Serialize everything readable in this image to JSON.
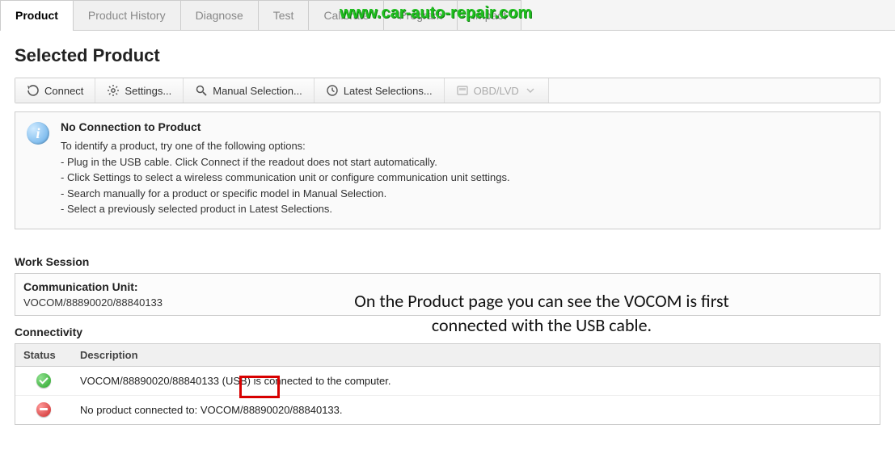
{
  "watermark": "www.car-auto-repair.com",
  "tabs": [
    {
      "label": "Product",
      "active": true
    },
    {
      "label": "Product History",
      "active": false
    },
    {
      "label": "Diagnose",
      "active": false
    },
    {
      "label": "Test",
      "active": false
    },
    {
      "label": "Calibrate",
      "active": false
    },
    {
      "label": "Program",
      "active": false
    },
    {
      "label": "Impact",
      "active": false
    }
  ],
  "page_title": "Selected Product",
  "toolbar": {
    "connect": "Connect",
    "settings": "Settings...",
    "manual": "Manual Selection...",
    "latest": "Latest Selections...",
    "obd": "OBD/LVD"
  },
  "info": {
    "title": "No Connection to Product",
    "intro": "To identify a product, try one of the following options:",
    "lines": [
      "- Plug in the USB cable. Click Connect if the readout does not start automatically.",
      "- Click Settings to select a wireless communication unit or configure communication unit settings.",
      "- Search manually for a product or specific model in Manual Selection.",
      "- Select a previously selected product in Latest Selections."
    ]
  },
  "work_session_header": "Work Session",
  "comm_unit": {
    "label": "Communication Unit:",
    "value": "VOCOM/88890020/88840133"
  },
  "connectivity_header": "Connectivity",
  "conn_columns": {
    "status": "Status",
    "description": "Description"
  },
  "conn_rows": [
    {
      "status": "ok",
      "desc": "VOCOM/88890020/88840133 (USB) is connected to the computer."
    },
    {
      "status": "err",
      "desc": "No product connected to: VOCOM/88890020/88840133."
    }
  ],
  "annotation": "On the Product page you can see the VOCOM is first connected with the USB cable."
}
